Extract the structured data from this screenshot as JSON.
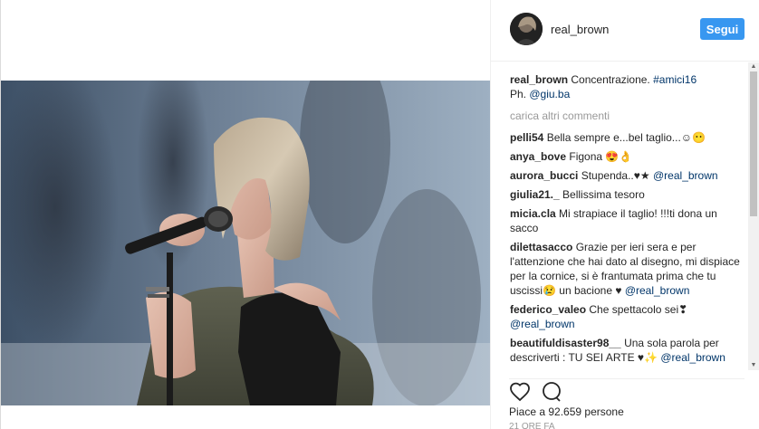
{
  "post": {
    "username": "real_brown",
    "follow_label": "Segui",
    "caption_user": "real_brown",
    "caption_text": "Concentrazione.",
    "caption_hashtag": "#amici16",
    "caption_credit_prefix": "Ph.",
    "caption_credit_handle": "@giu.ba",
    "load_more_label": "carica altri commenti",
    "likes_text": "Piace a 92.659 persone",
    "timestamp": "21 ORE FA"
  },
  "comments": [
    {
      "user": "pelli54",
      "text": "Bella sempre e...bel taglio...☺😶"
    },
    {
      "user": "anya_bove",
      "text": "Figona 😍👌"
    },
    {
      "user": "aurora_bucci",
      "text": "Stupenda..♥★",
      "mention": "@real_brown"
    },
    {
      "user": "giulia21._",
      "text": "Bellissima tesoro"
    },
    {
      "user": "micia.cla",
      "text": "Mi strapiace il taglio! !!!ti dona un sacco"
    },
    {
      "user": "dilettasacco",
      "text": "Grazie per ieri sera e per l'attenzione che hai dato al disegno, mi dispiace per la cornice, si è frantumata prima che tu uscissi😢 un bacione ♥",
      "mention": "@real_brown"
    },
    {
      "user": "federico_valeo",
      "text": "Che spettacolo sei❣",
      "mention": "@real_brown"
    },
    {
      "user": "beautifuldisaster98__",
      "text": "Una sola parola per descriverti : TU SEI ARTE ♥✨",
      "mention": "@real_brown"
    }
  ],
  "icons": {
    "like": "heart-icon",
    "comment": "comment-icon"
  },
  "colors": {
    "follow_button": "#3897f0",
    "link": "#003569",
    "muted": "#999999"
  }
}
